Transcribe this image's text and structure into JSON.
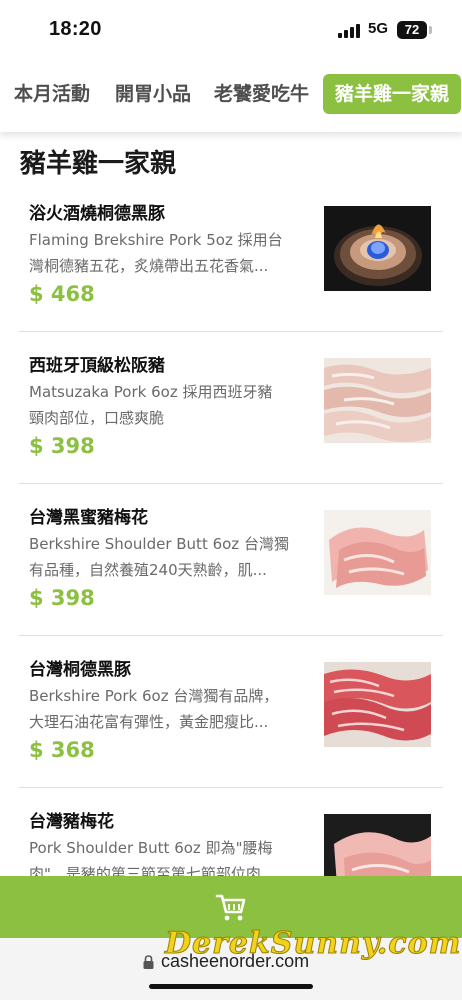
{
  "status_bar": {
    "time": "18:20",
    "network": "5G",
    "battery": "72"
  },
  "tabs": [
    {
      "label": "本月活動",
      "active": false
    },
    {
      "label": "開胃小品",
      "active": false
    },
    {
      "label": "老饕愛吃牛",
      "active": false
    },
    {
      "label": "豬羊雞一家親",
      "active": true
    }
  ],
  "section": {
    "title": "豬羊雞一家親"
  },
  "items": [
    {
      "name": "浴火酒燒桐德黑豚",
      "desc_line1": "Flaming Brekshire Pork 5oz 採用台",
      "desc_line2": "灣桐德豬五花，炙燒帶出五花香氣...",
      "price": "$ 468",
      "image": "flaming-pork-pot-image"
    },
    {
      "name": "西班牙頂級松阪豬",
      "desc_line1": "Matsuzaka Pork 6oz 採用西班牙豬",
      "desc_line2": "頸肉部位，口感爽脆",
      "price": "$ 398",
      "image": "matsuzaka-pork-slices-image"
    },
    {
      "name": "台灣黑蜜豬梅花",
      "desc_line1": "Berkshire Shoulder Butt 6oz 台灣獨",
      "desc_line2": "有品種，自然養殖240天熟齡，肌...",
      "price": "$ 398",
      "image": "pork-shoulder-slices-image"
    },
    {
      "name": "台灣桐德黑豚",
      "desc_line1": "Berkshire Pork 6oz 台灣獨有品牌，",
      "desc_line2": "大理石油花富有彈性，黃金肥瘦比...",
      "price": "$ 368",
      "image": "berkshire-pork-slices-image"
    },
    {
      "name": "台灣豬梅花",
      "desc_line1": "Pork Shoulder Butt 6oz 即為\"腰梅",
      "desc_line2": "肉\"，是豬的第三節至第七節部位肉",
      "price": "",
      "image": "pork-butt-slices-image"
    }
  ],
  "cart": {
    "icon": "shopping-cart-icon"
  },
  "browser": {
    "url": "casheenorder.com",
    "icon": "lock-icon"
  },
  "watermark": "DerekSunny.com",
  "colors": {
    "accent": "#8cc041",
    "text_dark": "#111111",
    "text_muted": "#6a6a6a",
    "divider": "#dedede"
  }
}
